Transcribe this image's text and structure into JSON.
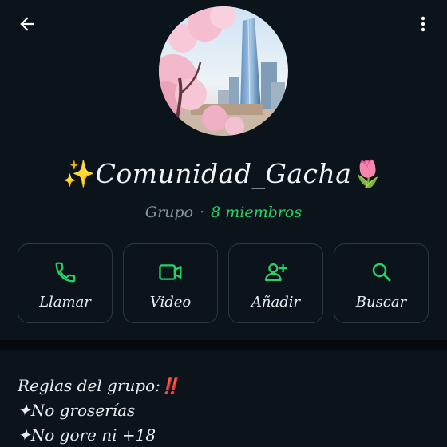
{
  "header": {
    "back_icon": "arrow-left-icon",
    "menu_icon": "more-vertical-icon"
  },
  "group": {
    "name_prefix_emoji": "✨",
    "name": "Comunidad_Gacha",
    "name_suffix_emoji": "🌷",
    "type": "Grupo",
    "separator": "·",
    "members": "8 miembros"
  },
  "actions": [
    {
      "label": "Llamar",
      "icon": "phone-icon"
    },
    {
      "label": "Video",
      "icon": "video-icon"
    },
    {
      "label": "Añadir",
      "icon": "add-person-icon"
    },
    {
      "label": "Buscar",
      "icon": "search-icon"
    }
  ],
  "description": {
    "lines": [
      "Reglas del grupo:‼️",
      "✦No groserías",
      "✦No gore ni +18"
    ]
  },
  "colors": {
    "background": "#0b141a",
    "accent": "#25d366",
    "muted": "#8696a0",
    "card_border": "#2a3942"
  }
}
